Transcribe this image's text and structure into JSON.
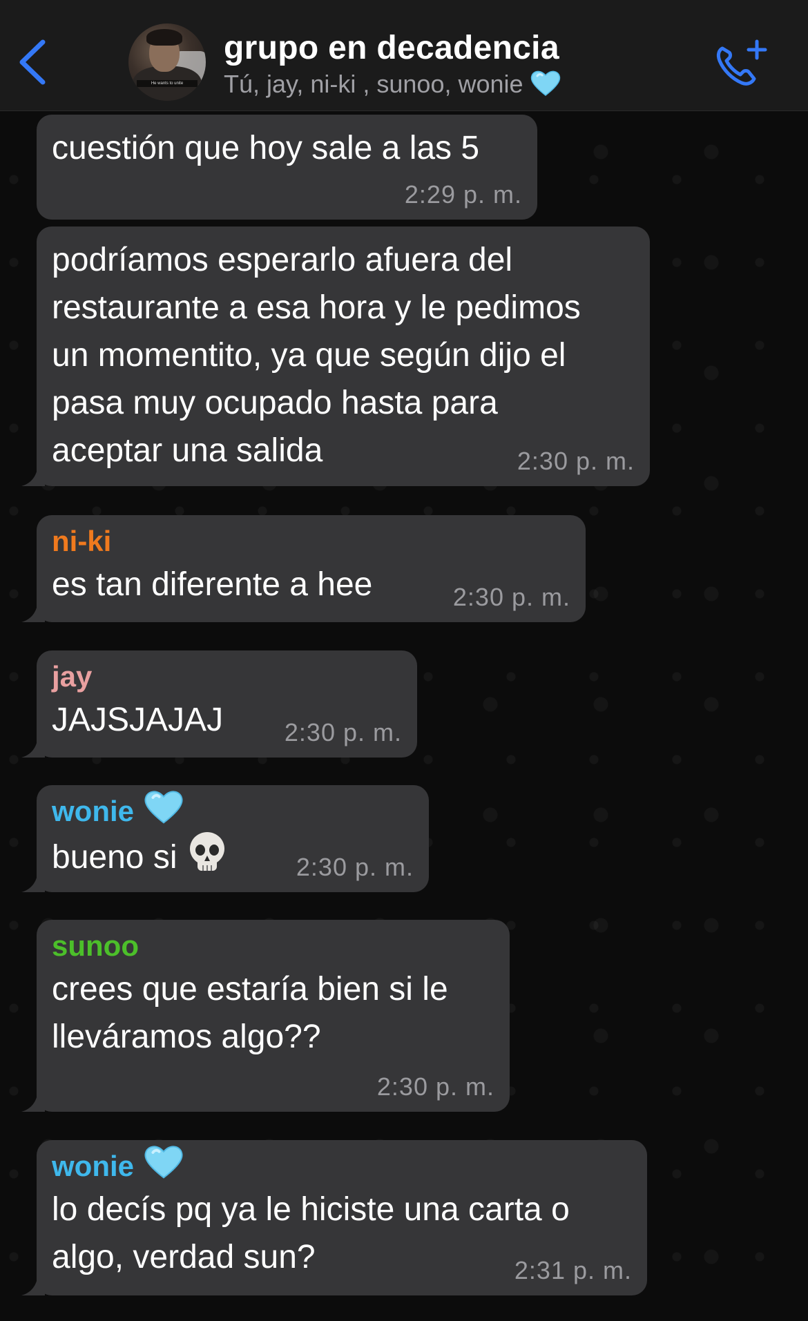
{
  "header": {
    "title": "grupo en decadencia",
    "subtitle": "Tú, jay, ni-ki , sunoo, wonie",
    "avatar_caption": "He wants to unite",
    "accent_color": "#3478f6",
    "icons": {
      "back": "chevron-left-icon",
      "call": "add-call-icon",
      "heart": "light-blue-heart-icon"
    }
  },
  "messages": [
    {
      "sender": "",
      "sender_color": "",
      "text": "cuestión que hoy sale a las 5",
      "time": "2:29 p. m."
    },
    {
      "sender": "",
      "sender_color": "",
      "text": "podríamos esperarlo afuera del\nrestaurante a esa hora y le pedimos\nun momentito, ya que según dijo el\npasa muy ocupado hasta para\naceptar una salida",
      "time": "2:30 p. m."
    },
    {
      "sender": "ni-ki",
      "sender_color": "#f07a1e",
      "text": "es tan diferente a hee",
      "time": "2:30 p. m."
    },
    {
      "sender": "jay",
      "sender_color": "#e9a0a0",
      "text": "JAJSJAJAJ",
      "time": "2:30 p. m."
    },
    {
      "sender": "wonie",
      "sender_color": "#3fb8ec",
      "text": "bueno si",
      "time": "2:30 p. m.",
      "emoji": "skull-icon"
    },
    {
      "sender": "sunoo",
      "sender_color": "#4cbf2a",
      "text": "crees que estaría bien si le\nlleváramos algo??",
      "time": "2:30 p. m."
    },
    {
      "sender": "wonie",
      "sender_color": "#3fb8ec",
      "text": "lo decís pq ya le hiciste una carta o\nalgo, verdad sun?",
      "time": "2:31 p. m."
    }
  ]
}
